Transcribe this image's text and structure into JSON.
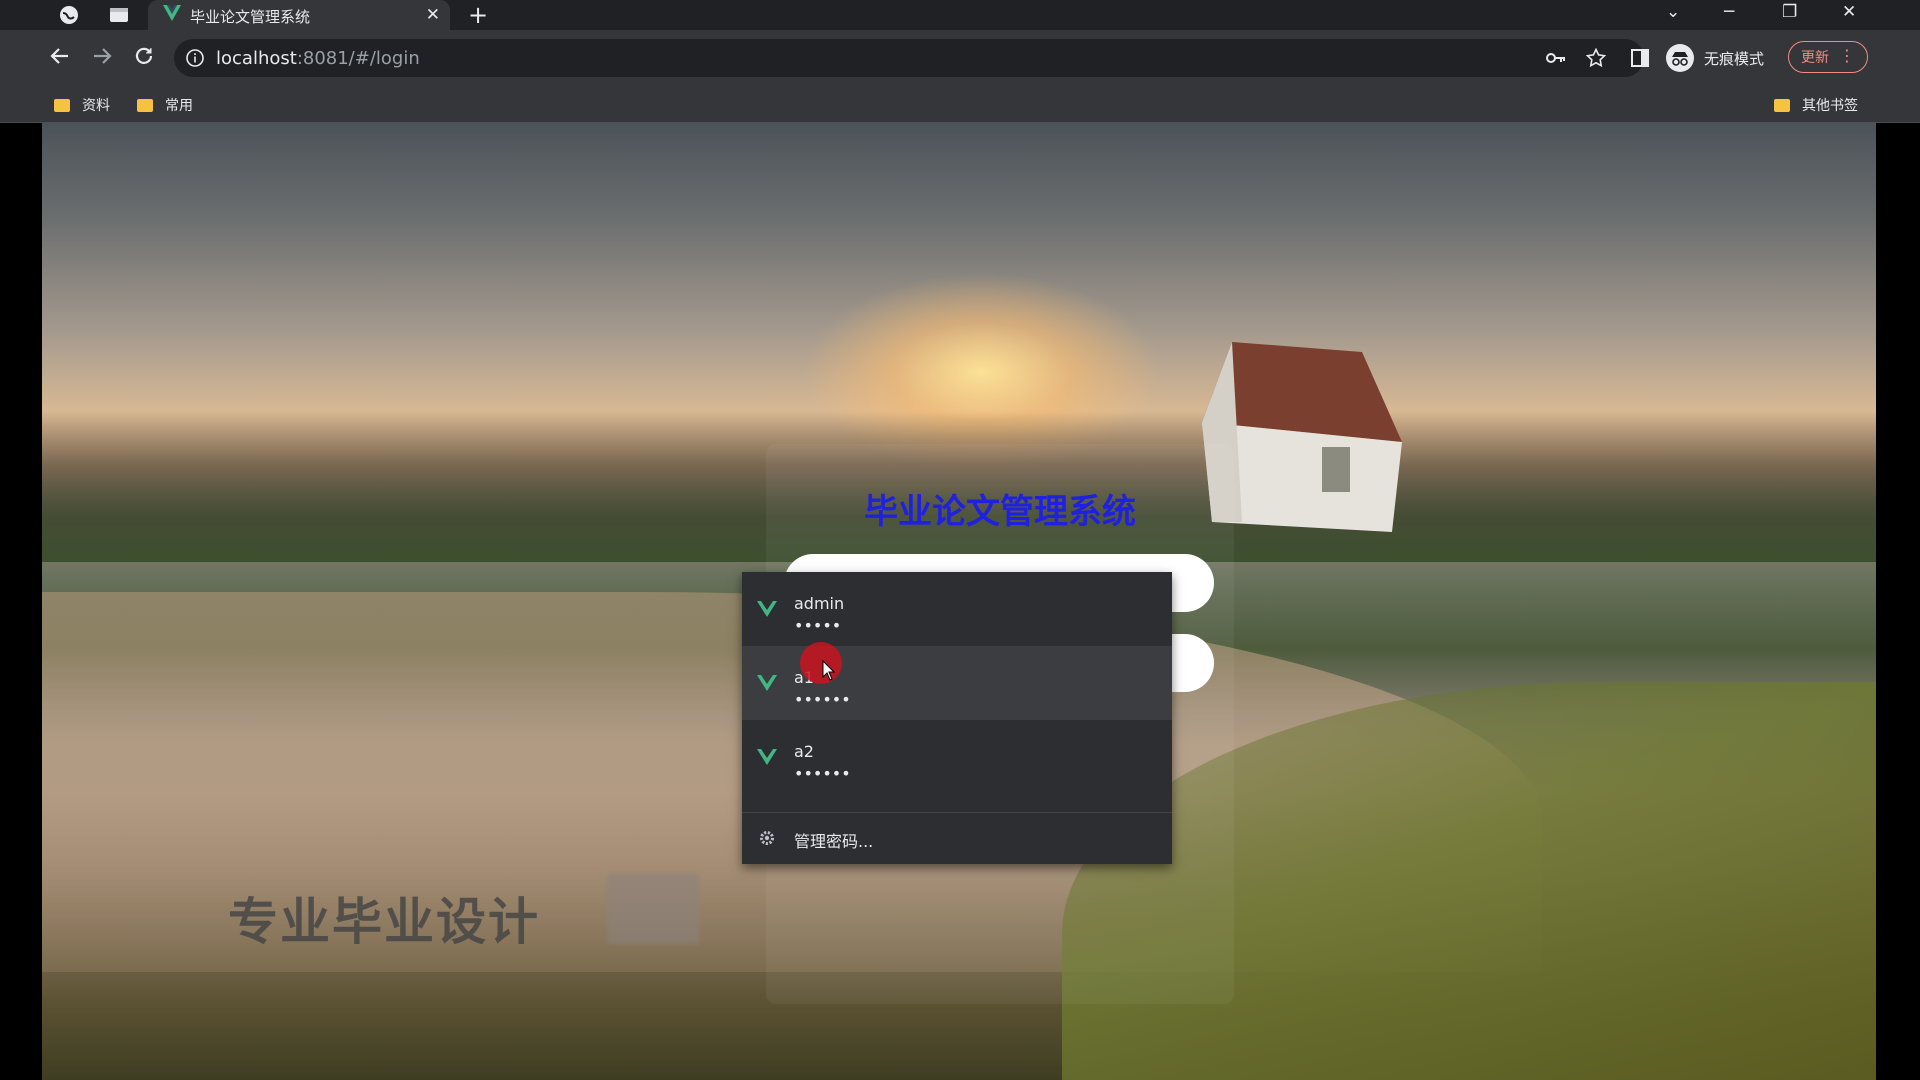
{
  "browser": {
    "tab_title": "毕业论文管理系统",
    "tab_close": "✕",
    "new_tab": "+",
    "url_host": "localhost",
    "url_path": ":8081/#/login",
    "incognito_label": "无痕模式",
    "update_label": "更新",
    "update_menu": "⋮",
    "bookmarks": [
      "资料",
      "常用"
    ],
    "other_bookmarks": "其他书签",
    "window_controls": [
      "⌄",
      "─",
      "❐",
      "✕"
    ]
  },
  "login": {
    "title": "毕业论文管理系统",
    "username_value": "a1",
    "password_value": "••••••"
  },
  "autofill": {
    "items": [
      {
        "username": "admin",
        "password": "•••••"
      },
      {
        "username": "a1",
        "password": "••••••"
      },
      {
        "username": "a2",
        "password": "••••••"
      }
    ],
    "manage_label": "管理密码..."
  },
  "watermark": "专业毕业设计",
  "colors": {
    "title_blue": "#2020e0",
    "vue_green": "#41b883",
    "chrome_dark": "#202124",
    "chrome_toolbar": "#35363a"
  }
}
